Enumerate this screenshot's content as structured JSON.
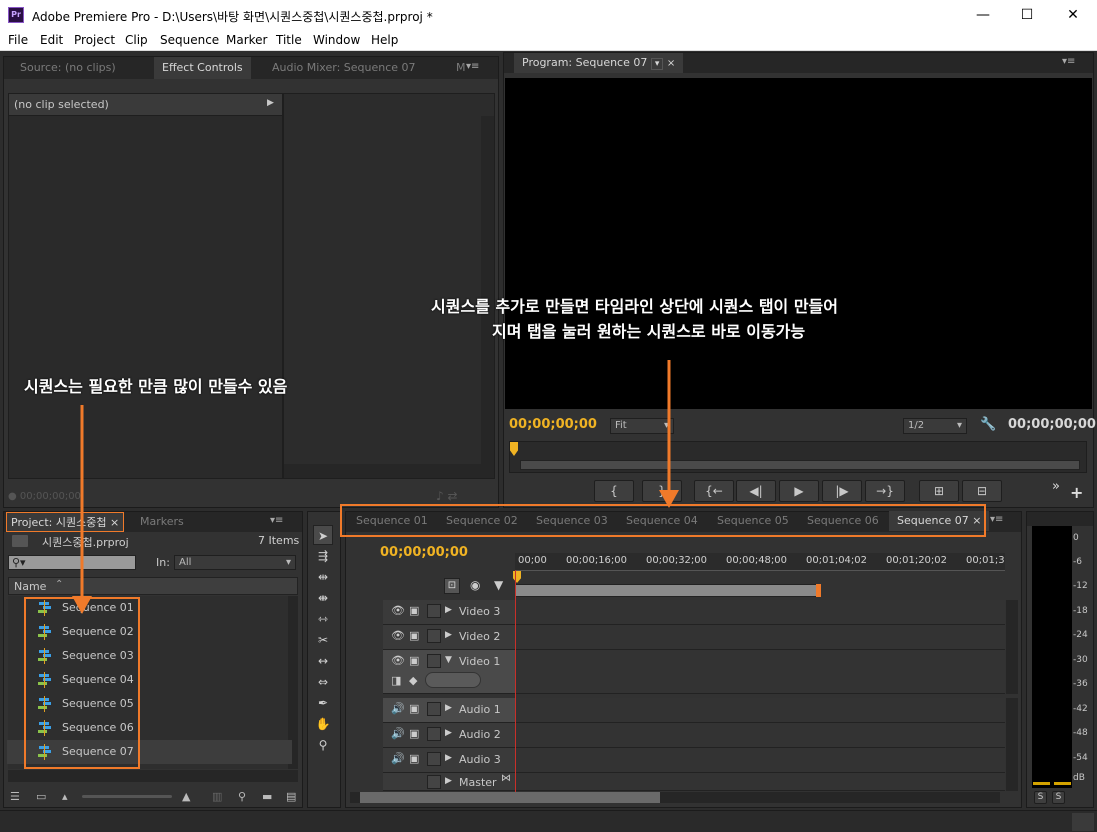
{
  "window": {
    "title": "Adobe Premiere Pro - D:\\Users\\바탕 화면\\시퀀스중첩\\시퀀스중첩.prproj *",
    "app_icon": "Pr",
    "minimize": "—",
    "maximize": "☐",
    "close": "✕"
  },
  "menu": [
    "File",
    "Edit",
    "Project",
    "Clip",
    "Sequence",
    "Marker",
    "Title",
    "Window",
    "Help"
  ],
  "source_panel": {
    "tabs": [
      "Source: (no clips)",
      "Effect Controls",
      "Audio Mixer: Sequence 07",
      "M"
    ],
    "active_tab": 1,
    "no_clip": "(no clip selected)",
    "timecode": "00;00;00;00"
  },
  "program_panel": {
    "tab": "Program: Sequence 07",
    "timecode_left": "00;00;00;00",
    "fit": "Fit",
    "resolution": "1/2",
    "timecode_right": "00;00;00;00",
    "controls": [
      "{",
      "}",
      "{←",
      "◀|",
      "▶",
      "|▶",
      "→}",
      "⊞",
      "⊟"
    ],
    "more": "»",
    "add": "+"
  },
  "project_panel": {
    "tabs": [
      "Project: 시퀀스중첩",
      "Markers"
    ],
    "file_name": "시퀀스중첩.prproj",
    "item_count": "7 Items",
    "in_label": "In:",
    "in_value": "All",
    "name_header": "Name",
    "sequences": [
      "Sequence 01",
      "Sequence 02",
      "Sequence 03",
      "Sequence 04",
      "Sequence 05",
      "Sequence 06",
      "Sequence 07"
    ]
  },
  "timeline": {
    "tabs": [
      "Sequence 01",
      "Sequence 02",
      "Sequence 03",
      "Sequence 04",
      "Sequence 05",
      "Sequence 06",
      "Sequence 07"
    ],
    "active_tab": 6,
    "timecode": "00;00;00;00",
    "ruler": [
      "00;00",
      "00;00;16;00",
      "00;00;32;00",
      "00;00;48;00",
      "00;01;04;02",
      "00;01;20;02",
      "00;01;3"
    ],
    "video_tracks": [
      "Video 3",
      "Video 2",
      "Video 1"
    ],
    "audio_tracks": [
      "Audio 1",
      "Audio 2",
      "Audio 3"
    ],
    "master": "Master"
  },
  "audio_meter": {
    "ticks": [
      "0",
      "-6",
      "-12",
      "-18",
      "-24",
      "-30",
      "-36",
      "-42",
      "-48",
      "-54",
      "dB"
    ],
    "solo": [
      "S",
      "S"
    ]
  },
  "annotations": {
    "left": "시퀀스는 필요한 만큼 많이 만들수 있음",
    "right_line1": "시퀀스를 추가로 만들면 타임라인 상단에 시퀀스 탭이 만들어",
    "right_line2": "지며 탭을 눌러 원하는 시퀀스로 바로 이동가능"
  },
  "colors": {
    "accent_orange": "#f07a2a",
    "timecode_yellow": "#f0b323",
    "panel_bg": "#323232"
  }
}
